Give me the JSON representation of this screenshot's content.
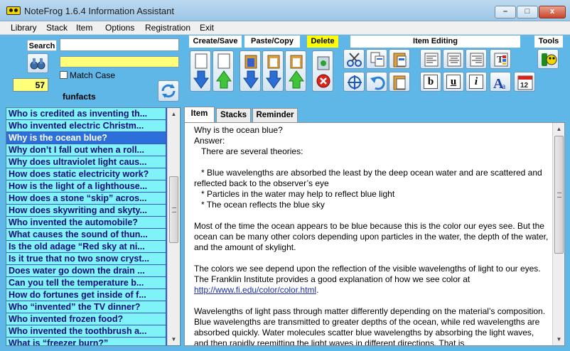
{
  "window": {
    "title": "NoteFrog 1.6.4 Information Assistant",
    "min_glyph": "–",
    "max_glyph": "□",
    "close_glyph": "x"
  },
  "menu": [
    "Library",
    "Stack",
    "Item",
    "Options",
    "Registration",
    "Exit"
  ],
  "search": {
    "label": "Search",
    "value": "",
    "match_case_label": "Match Case",
    "match_case_checked": false,
    "count": "57",
    "stack_name": "funfacts"
  },
  "toolbar": {
    "sections": {
      "create_save": "Create/Save",
      "paste_copy": "Paste/Copy",
      "delete": "Delete",
      "item_editing": "Item Editing",
      "tools": "Tools"
    },
    "format": {
      "bold": "b",
      "underline": "u",
      "italic": "i"
    },
    "calendar_day": "12"
  },
  "items": [
    "Who is credited as inventing th...",
    "Who invented electric Christm...",
    "Why is the ocean blue?",
    "Why don’t I fall out when a roll...",
    "Why does ultraviolet light caus...",
    "How does static electricity work?",
    "How is the light of a lighthouse...",
    "How does a stone “skip” acros...",
    "How does skywriting and skyty...",
    "Who invented the automobile?",
    "What causes the sound of thun...",
    "Is the old adage “Red sky at ni...",
    "Is it true that no two snow cryst...",
    "Does water go down the drain ...",
    "Can you tell the temperature b...",
    "How do fortunes get inside of f...",
    "Who “invented” the TV dinner?",
    "Who invented frozen food?",
    "Who invented the toothbrush a...",
    "What is “freezer burn?”"
  ],
  "selected_index": 2,
  "tabs": [
    "Item",
    "Stacks",
    "Reminder"
  ],
  "active_tab": 0,
  "content": {
    "question": "Why is the ocean blue?",
    "answer_label": "Answer:",
    "p1": "   There are several theories:",
    "bullet1": "   * Blue wavelengths are absorbed the least by the deep ocean water and are scattered and reflected back to the observer’s eye",
    "bullet2": "   * Particles in the water may help to reflect blue light",
    "bullet3": "   * The ocean reflects the blue sky",
    "p2": "Most of the time the ocean appears to be blue because this is the color our eyes see. But the ocean can be many other colors depending upon particles in the water, the depth of the water, and the amount of skylight.",
    "p3": "The colors we see depend upon the reflection of the visible wavelengths of light to our eyes. The Franklin Institute provides a good explanation of how we see color at",
    "link": "http://www.fi.edu/color/color.html",
    "link_suffix": ".",
    "p4": "Wavelengths of light pass through matter differently depending on the material’s composition. Blue wavelengths are transmitted to greater depths of the ocean, while red wavelengths are absorbed quickly. Water molecules scatter blue wavelengths by absorbing the light waves, and then rapidly reemitting the light waves in different directions. That is"
  },
  "colors": {
    "background": "#5fb7e8",
    "list_item": "#7ff3f7",
    "list_selected": "#2d6fda",
    "highlight_yellow": "#ffff7a",
    "delete_label": "#ffff00"
  }
}
